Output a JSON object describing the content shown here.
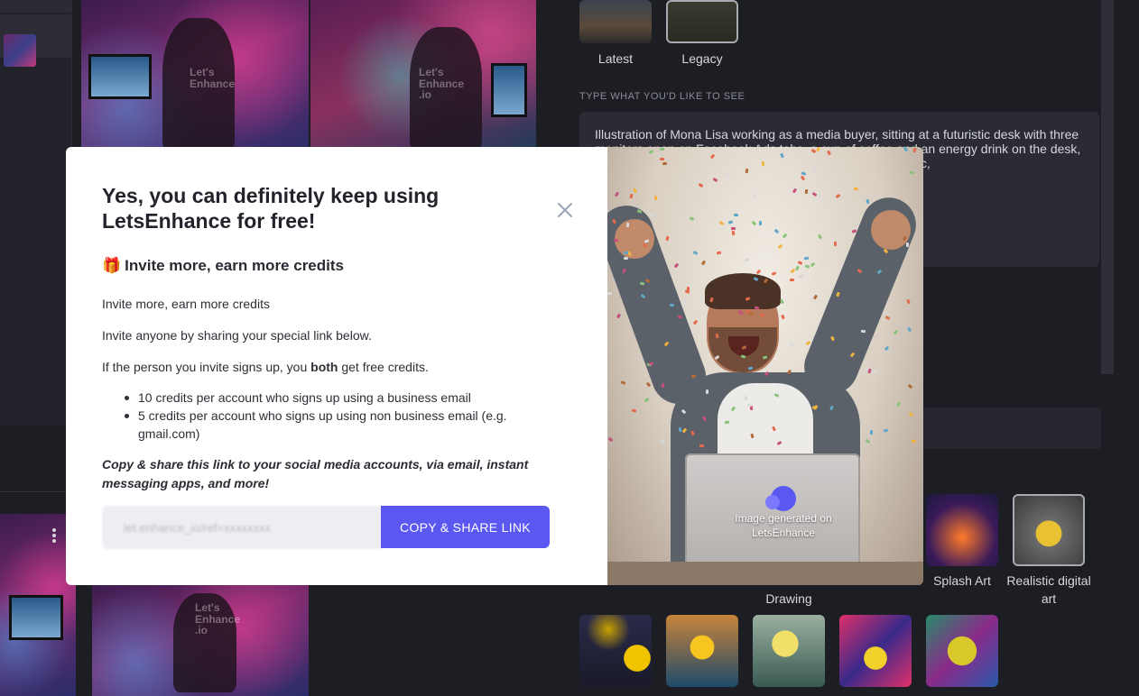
{
  "models": {
    "latest_label": "Latest",
    "legacy_label": "Legacy"
  },
  "prompt": {
    "section_label": "TYPE WHAT YOU'D LIKE TO SEE",
    "text": "Illustration of Mona Lisa working as a media buyer, sitting at a futuristic desk with three monitors open on Facebook Ads tabs, a cup of coffee and an energy drink on the desk, neon lit cyberpunk office in the background, Hyper Realistic,"
  },
  "watermarks": {
    "line1": "Let's",
    "line2": "Enhance",
    "line3": ".io"
  },
  "styles": {
    "drawing_label": "Drawing",
    "splash_art_label": "Splash Art",
    "realistic_label": "Realistic digital art"
  },
  "modal": {
    "title": "Yes, you can definitely keep using LetsEnhance for free!",
    "gift_emoji": "🎁",
    "subheading": "Invite more, earn more credits",
    "p1": "Invite more, earn more credits",
    "p2": "Invite anyone by sharing your special link below.",
    "p3_pre": "If the person you invite signs up, you ",
    "p3_bold": "both",
    "p3_post": " get free credits.",
    "bullets": [
      "10 credits per account who signs up using a business email",
      "5 credits per account who signs up using non business email (e.g. gmail.com)"
    ],
    "share_note": "Copy & share this link to your social media accounts, via email, instant messaging apps, and more!",
    "link_value": "let.enhance_io/ref=xxxxxxxx",
    "copy_button": "COPY & SHARE LINK",
    "image_caption": "Image generated on LetsEnhance"
  },
  "colors": {
    "accent": "#5b58f2",
    "background": "#1d1e24"
  }
}
